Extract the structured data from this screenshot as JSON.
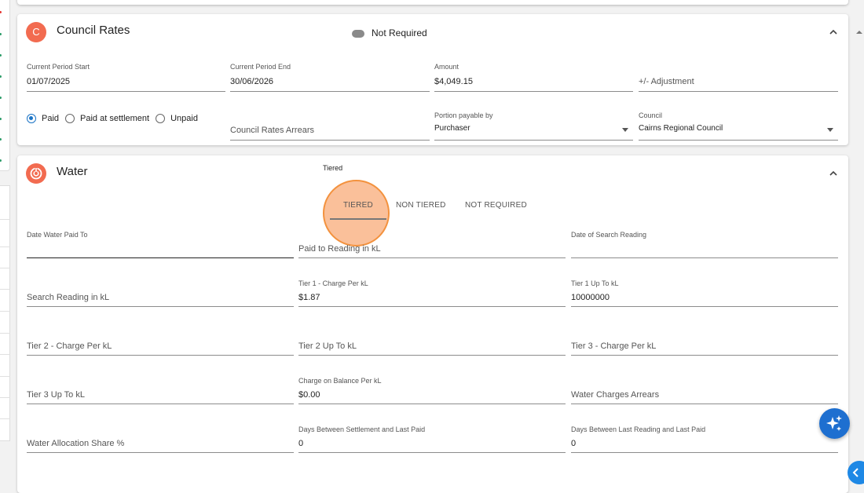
{
  "colors": {
    "accent_orange": "#f26b50",
    "radio_blue": "#1a73c5",
    "fab_blue": "#1e6fd0",
    "ripple_orange": "#f3923e"
  },
  "council": {
    "avatar_letter": "C",
    "title": "Council Rates",
    "toggle_label": "Not Required",
    "current_period_start": {
      "label": "Current Period Start",
      "value": "01/07/2025"
    },
    "current_period_end": {
      "label": "Current Period End",
      "value": "30/06/2026"
    },
    "amount": {
      "label": "Amount",
      "value": "$4,049.15"
    },
    "adjustment": {
      "placeholder": "+/- Adjustment"
    },
    "payment_status": {
      "options": [
        "Paid",
        "Paid at settlement",
        "Unpaid"
      ],
      "selected": "Paid"
    },
    "arrears": {
      "placeholder": "Council Rates Arrears"
    },
    "portion_payable_by": {
      "label": "Portion payable by",
      "value": "Purchaser"
    },
    "council_select": {
      "label": "Council",
      "value": "Cairns Regional Council"
    }
  },
  "water": {
    "title": "Water",
    "avatar_icon": "water-meter-icon",
    "tiered_caption": "Tiered",
    "tabs": [
      "TIERED",
      "NON TIERED",
      "NOT REQUIRED"
    ],
    "active_tab": "TIERED",
    "date_water_paid_to": {
      "label": "Date Water Paid To",
      "value": ""
    },
    "paid_to_reading": {
      "placeholder": "Paid to Reading in kL"
    },
    "date_of_search_reading": {
      "label": "Date of Search Reading",
      "value": ""
    },
    "search_reading": {
      "placeholder": "Search Reading in kL"
    },
    "tier1_charge": {
      "label": "Tier 1 - Charge Per kL",
      "value": "$1.87"
    },
    "tier1_up_to": {
      "label": "Tier 1 Up To kL",
      "value": "10000000"
    },
    "tier2_charge": {
      "placeholder": "Tier 2 - Charge Per kL"
    },
    "tier2_up_to": {
      "placeholder": "Tier 2 Up To kL"
    },
    "tier3_charge": {
      "placeholder": "Tier 3 - Charge Per kL"
    },
    "tier3_up_to": {
      "placeholder": "Tier 3 Up To kL"
    },
    "charge_on_balance": {
      "label": "Charge on Balance Per kL",
      "value": "$0.00"
    },
    "water_arrears": {
      "placeholder": "Water Charges Arrears"
    },
    "allocation_share": {
      "placeholder": "Water Allocation Share %"
    },
    "days_settlement_last_paid": {
      "label": "Days Between Settlement and Last Paid",
      "value": "0"
    },
    "days_last_reading_last_paid": {
      "label": "Days Between Last Reading and Last Paid",
      "value": "0"
    }
  },
  "fab": {
    "icon": "sparkle-icon"
  },
  "side_tab": {
    "icon": "chevron-left-icon"
  }
}
